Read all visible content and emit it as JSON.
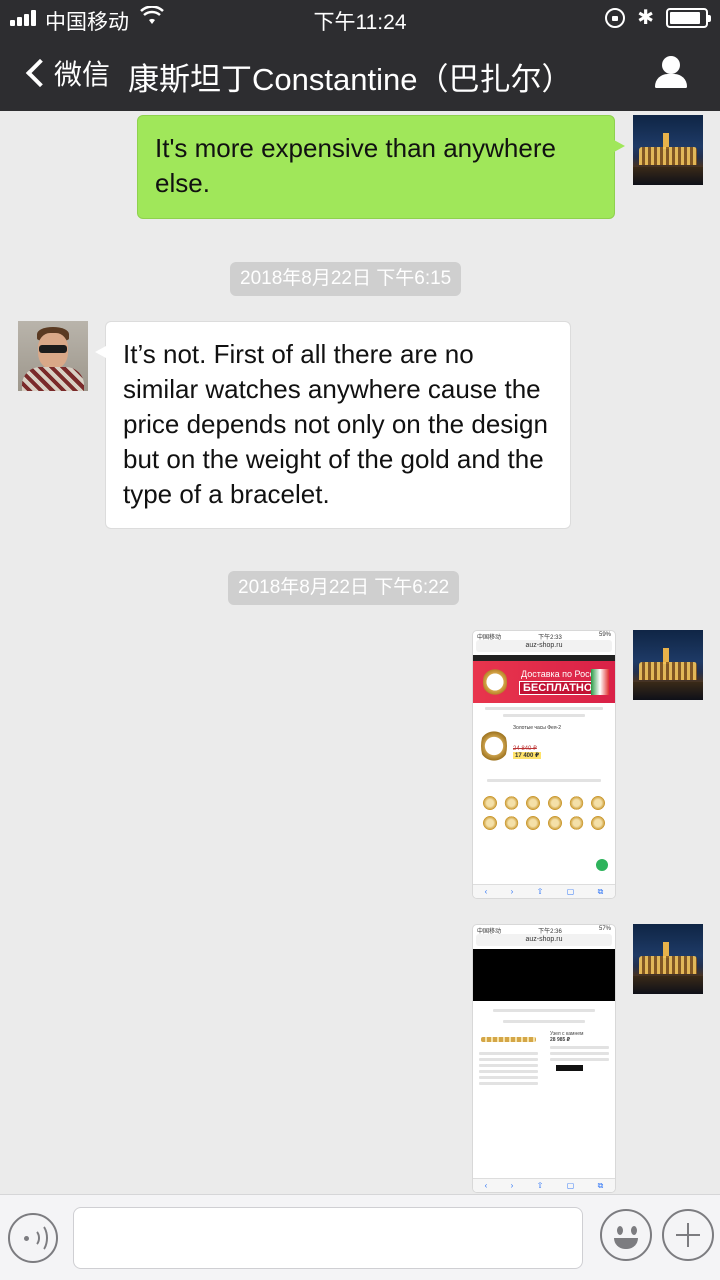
{
  "status_bar": {
    "carrier": "中国移动",
    "time": "下午11:24",
    "bluetooth_icon": "✱"
  },
  "nav": {
    "back_label": "微信",
    "title": "康斯坦丁Constantine（巴扎尔）"
  },
  "messages": [
    {
      "sender": "me",
      "text": "It's more expensive than anywhere else."
    },
    {
      "sender": "them",
      "text": "It’s not. First of all there are no similar watches anywhere cause the price depends not only on the design but on the weight of the gold and the type of a bracelet."
    }
  ],
  "timestamps": [
    "2018年8月22日 下午6:15",
    "2018年8月22日 下午6:22"
  ],
  "shots": [
    {
      "status_left": "中国移动",
      "time": "下午2:33",
      "battery": "59%",
      "url": "auz-shop.ru",
      "banner_line1": "Доставка по России",
      "banner_line2": "БЕСПЛАТНО!",
      "product_title": "Золотые часы Фея-2",
      "old_price": "24 840 ₽",
      "new_price": "17 400 ₽"
    },
    {
      "status_left": "中国移动",
      "time": "下午2:36",
      "battery": "57%",
      "url": "auz-shop.ru",
      "product_title": "Узел с камнем",
      "price": "28 985 ₽"
    }
  ],
  "input": {
    "value": ""
  },
  "colors": {
    "nav_bg": "#2d2d30",
    "outgoing": "#a0e75a",
    "incoming": "#ffffff",
    "chat_bg": "#ebebeb"
  },
  "icons": [
    "signal-icon",
    "wifi-icon",
    "rotation-lock-icon",
    "bluetooth-icon",
    "battery-icon",
    "back-chevron-icon",
    "profile-icon",
    "voice-icon",
    "emoji-icon",
    "plus-icon"
  ]
}
